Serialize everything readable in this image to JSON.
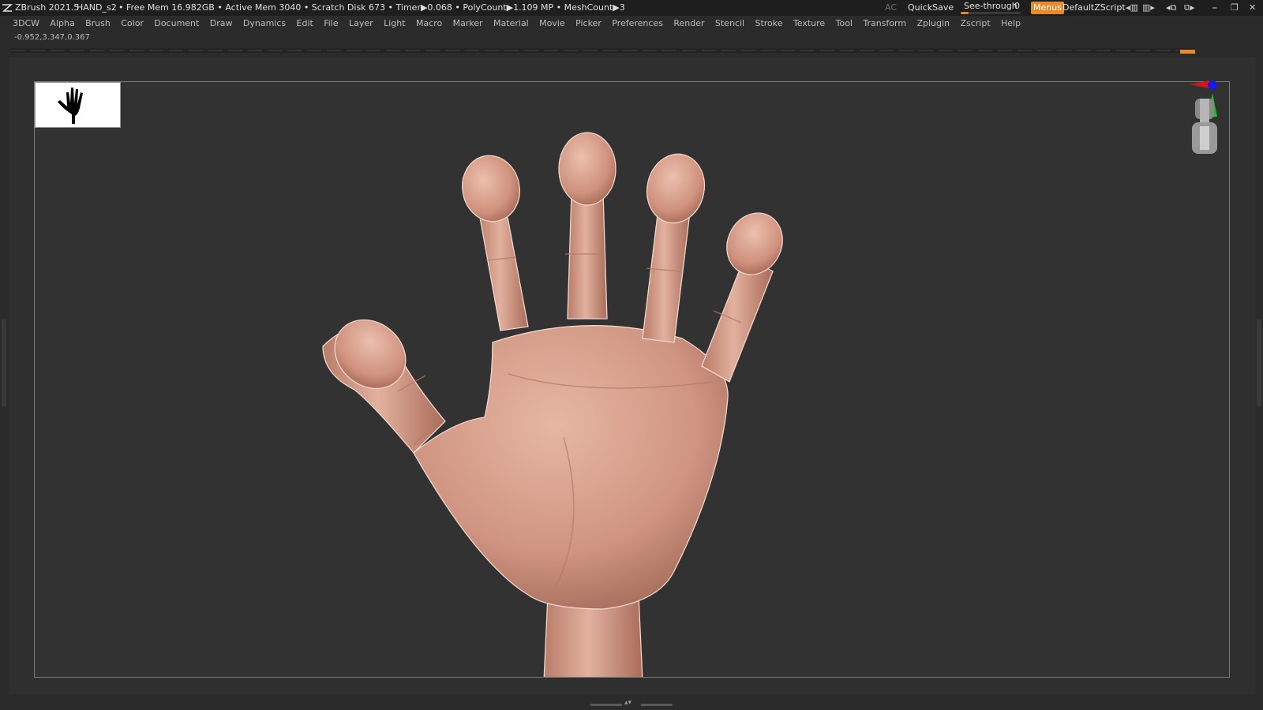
{
  "titlebar": {
    "app_name": "ZBrush 2021.5",
    "document_name": "HAND_s2",
    "stats": "• Free Mem 16.982GB • Active Mem 3040 • Scratch Disk 673 •  Timer▶0.068 • PolyCount▶1.109 MP  • MeshCount▶3",
    "ac_label": "AC",
    "quicksave_label": "QuickSave",
    "see_through_label": "See-through",
    "see_through_value": "0",
    "menus_label": "Menus",
    "script_name": "DefaultZScript"
  },
  "menubar": {
    "items": [
      "3DCW",
      "Alpha",
      "Brush",
      "Color",
      "Document",
      "Draw",
      "Dynamics",
      "Edit",
      "File",
      "Layer",
      "Light",
      "Macro",
      "Marker",
      "Material",
      "Movie",
      "Picker",
      "Preferences",
      "Render",
      "Stencil",
      "Stroke",
      "Texture",
      "Tool",
      "Transform",
      "Zplugin",
      "Zscript",
      "Help"
    ]
  },
  "status": {
    "coordinates": "-0.952,3.347,0.367"
  },
  "colors": {
    "accent": "#e8892b",
    "background": "#2b2b2b",
    "canvas": "#323232",
    "skin": "#d9a08a"
  },
  "icons": {
    "alpha_thumbnail": "hand-silhouette-icon",
    "navigator": "orientation-axes-icon"
  }
}
